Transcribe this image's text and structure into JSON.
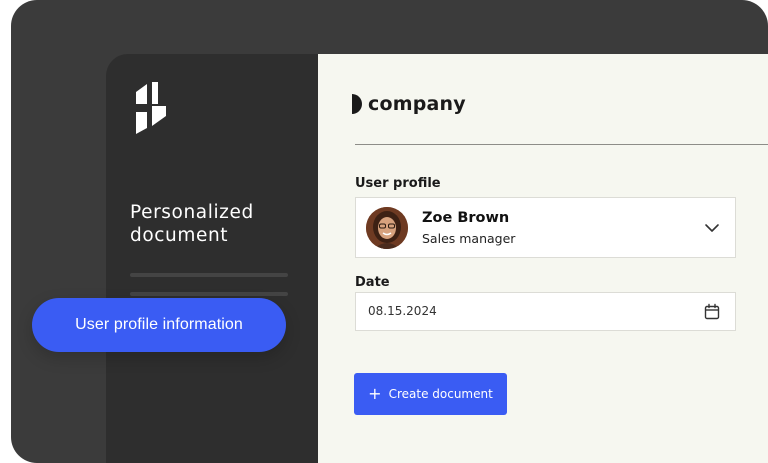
{
  "sidebar": {
    "title_line1": "Personalized",
    "title_line2": "document",
    "pill_label": "User profile information"
  },
  "brand": {
    "name": "company"
  },
  "form": {
    "user_profile_label": "User profile",
    "user": {
      "name": "Zoe Brown",
      "role": "Sales manager"
    },
    "date_label": "Date",
    "date_value": "08.15.2024",
    "create_button_label": "Create document"
  },
  "colors": {
    "accent": "#3a5cf3",
    "sidebar_bg": "#2e2e2e",
    "frame_bg": "#3b3b3b",
    "main_bg": "#f6f7f0"
  },
  "icons": [
    "app-logo-icon",
    "brand-mark-icon",
    "chevron-down-icon",
    "calendar-icon",
    "plus-icon"
  ]
}
